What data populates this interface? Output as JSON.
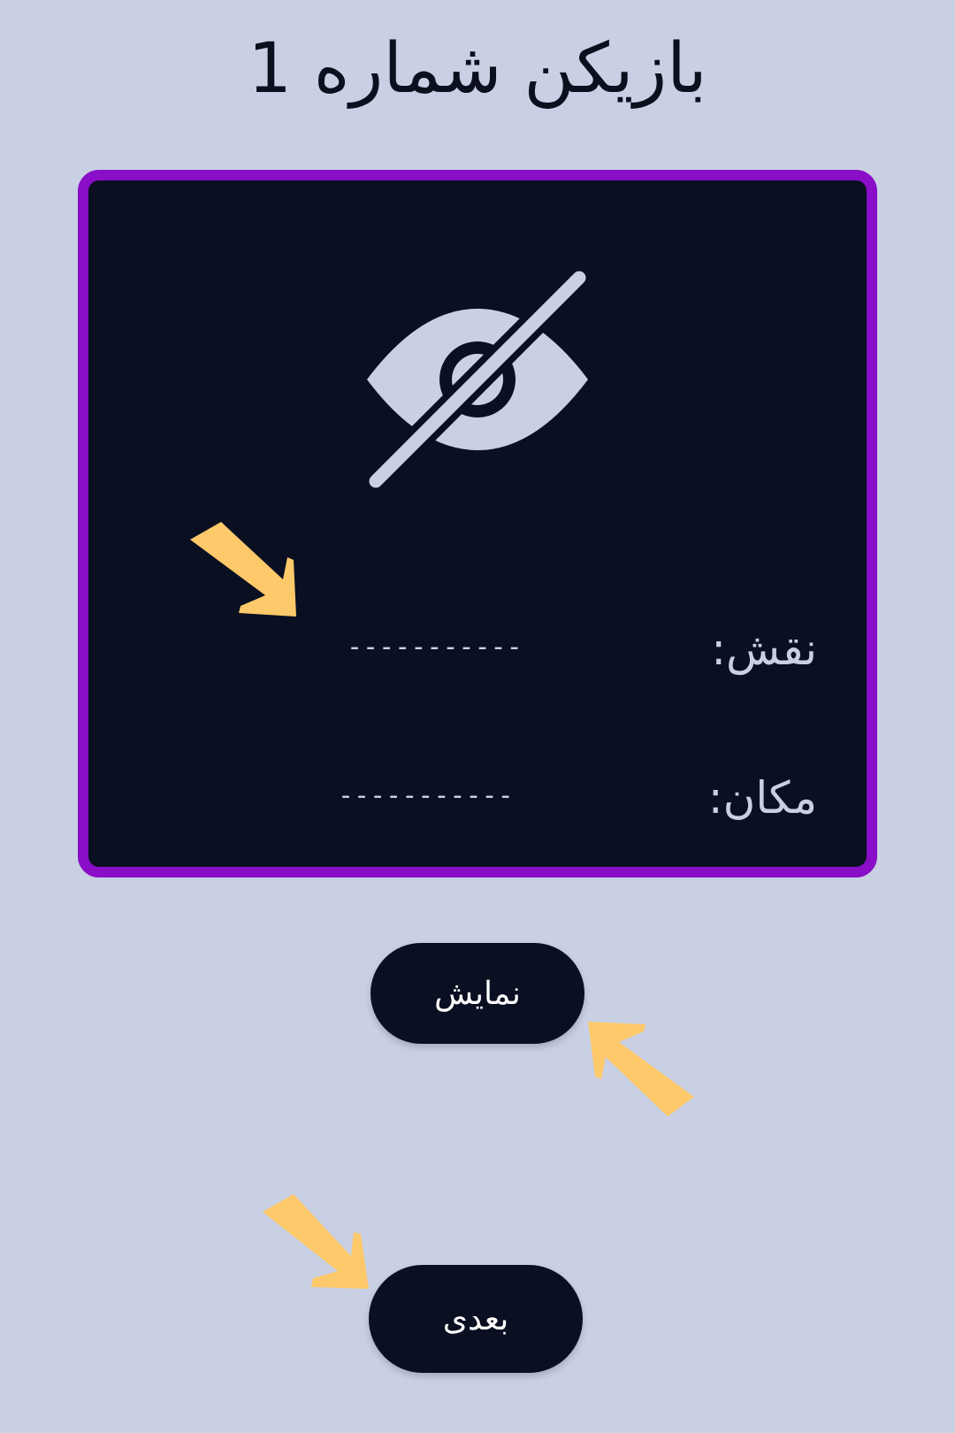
{
  "header": {
    "title": "بازیکن شماره 1"
  },
  "card": {
    "icon": "eye-off-icon",
    "role_label": "نقش:",
    "role_value": "-----------",
    "location_label": "مکان:",
    "location_value": "-----------"
  },
  "buttons": {
    "show_label": "نمایش",
    "next_label": "بعدی"
  },
  "colors": {
    "background": "#c9d0e3",
    "card_bg": "#0a0f21",
    "card_border": "#8a0dc8",
    "arrow": "#fdc96a",
    "button_bg": "#0a0f21"
  }
}
